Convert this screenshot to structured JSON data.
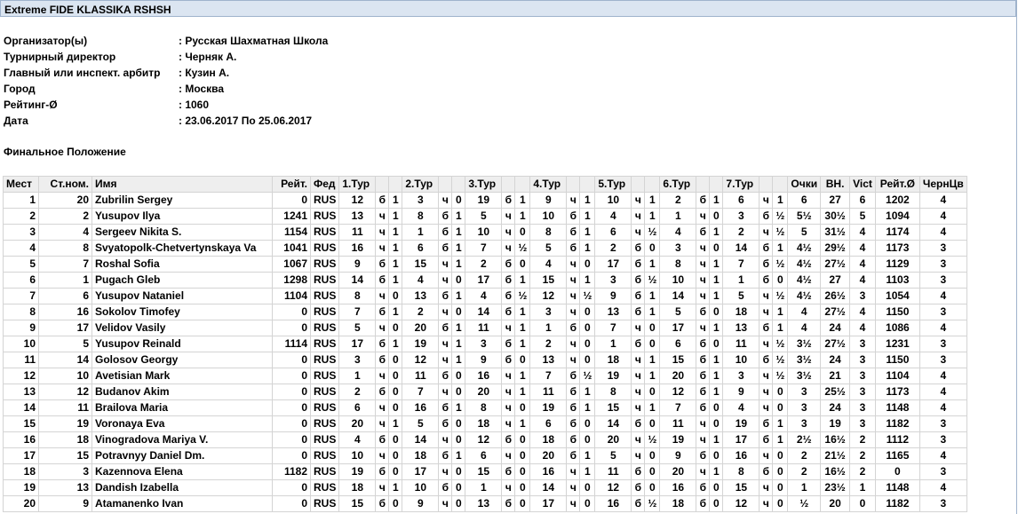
{
  "title": "Extreme FIDE KLASSIKA RSHSH",
  "info": [
    {
      "label": "Организатор(ы)",
      "value": ": Русская Шахматная Школа"
    },
    {
      "label": "Турнирный директор",
      "value": ": Черняк А."
    },
    {
      "label": "Главный или инспект. арбитр",
      "value": ": Кузин А."
    },
    {
      "label": "Город",
      "value": ": Москва"
    },
    {
      "label": "Рейтинг-Ø",
      "value": ": 1060"
    },
    {
      "label": "Дата",
      "value": ": 23.06.2017 По 25.06.2017"
    }
  ],
  "section_title": "Финальное Положение",
  "headers": {
    "place": "Мест",
    "start_no": "Ст.ном.",
    "name": "Имя",
    "rating": "Рейт.",
    "fed": "Фед",
    "rounds": [
      "1.Тур",
      "2.Тур",
      "3.Тур",
      "4.Тур",
      "5.Тур",
      "6.Тур",
      "7.Тур"
    ],
    "points": "Очки",
    "buchholz": "ВН.",
    "wins": "Vict",
    "avg_rating": "Рейт.Ø",
    "blacks": "ЧернЦв"
  },
  "rows": [
    {
      "place": "1",
      "start_no": "20",
      "name": "Zubrilin Sergey",
      "rating": "0",
      "fed": "RUS",
      "rounds": [
        [
          "12",
          "б",
          "1"
        ],
        [
          "3",
          "ч",
          "0"
        ],
        [
          "19",
          "б",
          "1"
        ],
        [
          "9",
          "ч",
          "1"
        ],
        [
          "10",
          "ч",
          "1"
        ],
        [
          "2",
          "б",
          "1"
        ],
        [
          "6",
          "ч",
          "1"
        ]
      ],
      "points": "6",
      "buchholz": "27",
      "wins": "6",
      "avg_rating": "1202",
      "blacks": "4"
    },
    {
      "place": "2",
      "start_no": "2",
      "name": "Yusupov Ilya",
      "rating": "1241",
      "fed": "RUS",
      "rounds": [
        [
          "13",
          "ч",
          "1"
        ],
        [
          "8",
          "б",
          "1"
        ],
        [
          "5",
          "ч",
          "1"
        ],
        [
          "10",
          "б",
          "1"
        ],
        [
          "4",
          "ч",
          "1"
        ],
        [
          "1",
          "ч",
          "0"
        ],
        [
          "3",
          "б",
          "½"
        ]
      ],
      "points": "5½",
      "buchholz": "30½",
      "wins": "5",
      "avg_rating": "1094",
      "blacks": "4"
    },
    {
      "place": "3",
      "start_no": "4",
      "name": "Sergeev Nikita S.",
      "rating": "1154",
      "fed": "RUS",
      "rounds": [
        [
          "11",
          "ч",
          "1"
        ],
        [
          "1",
          "б",
          "1"
        ],
        [
          "10",
          "ч",
          "0"
        ],
        [
          "8",
          "б",
          "1"
        ],
        [
          "6",
          "ч",
          "½"
        ],
        [
          "4",
          "б",
          "1"
        ],
        [
          "2",
          "ч",
          "½"
        ]
      ],
      "points": "5",
      "buchholz": "31½",
      "wins": "4",
      "avg_rating": "1174",
      "blacks": "4"
    },
    {
      "place": "4",
      "start_no": "8",
      "name": "Svyatopolk-Chetvertynskaya Va",
      "rating": "1041",
      "fed": "RUS",
      "rounds": [
        [
          "16",
          "ч",
          "1"
        ],
        [
          "6",
          "б",
          "1"
        ],
        [
          "7",
          "ч",
          "½"
        ],
        [
          "5",
          "б",
          "1"
        ],
        [
          "2",
          "б",
          "0"
        ],
        [
          "3",
          "ч",
          "0"
        ],
        [
          "14",
          "б",
          "1"
        ]
      ],
      "points": "4½",
      "buchholz": "29½",
      "wins": "4",
      "avg_rating": "1173",
      "blacks": "3"
    },
    {
      "place": "5",
      "start_no": "7",
      "name": "Roshal Sofia",
      "rating": "1067",
      "fed": "RUS",
      "rounds": [
        [
          "9",
          "б",
          "1"
        ],
        [
          "15",
          "ч",
          "1"
        ],
        [
          "2",
          "б",
          "0"
        ],
        [
          "4",
          "ч",
          "0"
        ],
        [
          "17",
          "б",
          "1"
        ],
        [
          "8",
          "ч",
          "1"
        ],
        [
          "7",
          "б",
          "½"
        ]
      ],
      "points": "4½",
      "buchholz": "27½",
      "wins": "4",
      "avg_rating": "1129",
      "blacks": "3"
    },
    {
      "place": "6",
      "start_no": "1",
      "name": "Pugach Gleb",
      "rating": "1298",
      "fed": "RUS",
      "rounds": [
        [
          "14",
          "б",
          "1"
        ],
        [
          "4",
          "ч",
          "0"
        ],
        [
          "17",
          "б",
          "1"
        ],
        [
          "15",
          "ч",
          "1"
        ],
        [
          "3",
          "б",
          "½"
        ],
        [
          "10",
          "ч",
          "1"
        ],
        [
          "1",
          "б",
          "0"
        ]
      ],
      "points": "4½",
      "buchholz": "27",
      "wins": "4",
      "avg_rating": "1103",
      "blacks": "3"
    },
    {
      "place": "7",
      "start_no": "6",
      "name": "Yusupov Nataniel",
      "rating": "1104",
      "fed": "RUS",
      "rounds": [
        [
          "8",
          "ч",
          "0"
        ],
        [
          "13",
          "б",
          "1"
        ],
        [
          "4",
          "б",
          "½"
        ],
        [
          "12",
          "ч",
          "½"
        ],
        [
          "9",
          "б",
          "1"
        ],
        [
          "14",
          "ч",
          "1"
        ],
        [
          "5",
          "ч",
          "½"
        ]
      ],
      "points": "4½",
      "buchholz": "26½",
      "wins": "3",
      "avg_rating": "1054",
      "blacks": "4"
    },
    {
      "place": "8",
      "start_no": "16",
      "name": "Sokolov Timofey",
      "rating": "0",
      "fed": "RUS",
      "rounds": [
        [
          "7",
          "б",
          "1"
        ],
        [
          "2",
          "ч",
          "0"
        ],
        [
          "14",
          "б",
          "1"
        ],
        [
          "3",
          "ч",
          "0"
        ],
        [
          "13",
          "б",
          "1"
        ],
        [
          "5",
          "б",
          "0"
        ],
        [
          "18",
          "ч",
          "1"
        ]
      ],
      "points": "4",
      "buchholz": "27½",
      "wins": "4",
      "avg_rating": "1150",
      "blacks": "3"
    },
    {
      "place": "9",
      "start_no": "17",
      "name": "Velidov Vasily",
      "rating": "0",
      "fed": "RUS",
      "rounds": [
        [
          "5",
          "ч",
          "0"
        ],
        [
          "20",
          "б",
          "1"
        ],
        [
          "11",
          "ч",
          "1"
        ],
        [
          "1",
          "б",
          "0"
        ],
        [
          "7",
          "ч",
          "0"
        ],
        [
          "17",
          "ч",
          "1"
        ],
        [
          "13",
          "б",
          "1"
        ]
      ],
      "points": "4",
      "buchholz": "24",
      "wins": "4",
      "avg_rating": "1086",
      "blacks": "4"
    },
    {
      "place": "10",
      "start_no": "5",
      "name": "Yusupov Reinald",
      "rating": "1114",
      "fed": "RUS",
      "rounds": [
        [
          "17",
          "б",
          "1"
        ],
        [
          "19",
          "ч",
          "1"
        ],
        [
          "3",
          "б",
          "1"
        ],
        [
          "2",
          "ч",
          "0"
        ],
        [
          "1",
          "б",
          "0"
        ],
        [
          "6",
          "б",
          "0"
        ],
        [
          "11",
          "ч",
          "½"
        ]
      ],
      "points": "3½",
      "buchholz": "27½",
      "wins": "3",
      "avg_rating": "1231",
      "blacks": "3"
    },
    {
      "place": "11",
      "start_no": "14",
      "name": "Golosov Georgy",
      "rating": "0",
      "fed": "RUS",
      "rounds": [
        [
          "3",
          "б",
          "0"
        ],
        [
          "12",
          "ч",
          "1"
        ],
        [
          "9",
          "б",
          "0"
        ],
        [
          "13",
          "ч",
          "0"
        ],
        [
          "18",
          "ч",
          "1"
        ],
        [
          "15",
          "б",
          "1"
        ],
        [
          "10",
          "б",
          "½"
        ]
      ],
      "points": "3½",
      "buchholz": "24",
      "wins": "3",
      "avg_rating": "1150",
      "blacks": "3"
    },
    {
      "place": "12",
      "start_no": "10",
      "name": "Avetisian Mark",
      "rating": "0",
      "fed": "RUS",
      "rounds": [
        [
          "1",
          "ч",
          "0"
        ],
        [
          "11",
          "б",
          "0"
        ],
        [
          "16",
          "ч",
          "1"
        ],
        [
          "7",
          "б",
          "½"
        ],
        [
          "19",
          "ч",
          "1"
        ],
        [
          "20",
          "б",
          "1"
        ],
        [
          "3",
          "ч",
          "½"
        ]
      ],
      "points": "3½",
      "buchholz": "21",
      "wins": "3",
      "avg_rating": "1104",
      "blacks": "4"
    },
    {
      "place": "13",
      "start_no": "12",
      "name": "Budanov Akim",
      "rating": "0",
      "fed": "RUS",
      "rounds": [
        [
          "2",
          "б",
          "0"
        ],
        [
          "7",
          "ч",
          "0"
        ],
        [
          "20",
          "ч",
          "1"
        ],
        [
          "11",
          "б",
          "1"
        ],
        [
          "8",
          "ч",
          "0"
        ],
        [
          "12",
          "б",
          "1"
        ],
        [
          "9",
          "ч",
          "0"
        ]
      ],
      "points": "3",
      "buchholz": "25½",
      "wins": "3",
      "avg_rating": "1173",
      "blacks": "4"
    },
    {
      "place": "14",
      "start_no": "11",
      "name": "Brailova Maria",
      "rating": "0",
      "fed": "RUS",
      "rounds": [
        [
          "6",
          "ч",
          "0"
        ],
        [
          "16",
          "б",
          "1"
        ],
        [
          "8",
          "ч",
          "0"
        ],
        [
          "19",
          "б",
          "1"
        ],
        [
          "15",
          "ч",
          "1"
        ],
        [
          "7",
          "б",
          "0"
        ],
        [
          "4",
          "ч",
          "0"
        ]
      ],
      "points": "3",
      "buchholz": "24",
      "wins": "3",
      "avg_rating": "1148",
      "blacks": "4"
    },
    {
      "place": "15",
      "start_no": "19",
      "name": "Voronaya Eva",
      "rating": "0",
      "fed": "RUS",
      "rounds": [
        [
          "20",
          "ч",
          "1"
        ],
        [
          "5",
          "б",
          "0"
        ],
        [
          "18",
          "ч",
          "1"
        ],
        [
          "6",
          "б",
          "0"
        ],
        [
          "14",
          "б",
          "0"
        ],
        [
          "11",
          "ч",
          "0"
        ],
        [
          "19",
          "б",
          "1"
        ]
      ],
      "points": "3",
      "buchholz": "19",
      "wins": "3",
      "avg_rating": "1182",
      "blacks": "3"
    },
    {
      "place": "16",
      "start_no": "18",
      "name": "Vinogradova Mariya V.",
      "rating": "0",
      "fed": "RUS",
      "rounds": [
        [
          "4",
          "б",
          "0"
        ],
        [
          "14",
          "ч",
          "0"
        ],
        [
          "12",
          "б",
          "0"
        ],
        [
          "18",
          "б",
          "0"
        ],
        [
          "20",
          "ч",
          "½"
        ],
        [
          "19",
          "ч",
          "1"
        ],
        [
          "17",
          "б",
          "1"
        ]
      ],
      "points": "2½",
      "buchholz": "16½",
      "wins": "2",
      "avg_rating": "1112",
      "blacks": "3"
    },
    {
      "place": "17",
      "start_no": "15",
      "name": "Potravnyy Daniel Dm.",
      "rating": "0",
      "fed": "RUS",
      "rounds": [
        [
          "10",
          "ч",
          "0"
        ],
        [
          "18",
          "б",
          "1"
        ],
        [
          "6",
          "ч",
          "0"
        ],
        [
          "20",
          "б",
          "1"
        ],
        [
          "5",
          "ч",
          "0"
        ],
        [
          "9",
          "б",
          "0"
        ],
        [
          "16",
          "ч",
          "0"
        ]
      ],
      "points": "2",
      "buchholz": "21½",
      "wins": "2",
      "avg_rating": "1165",
      "blacks": "4"
    },
    {
      "place": "18",
      "start_no": "3",
      "name": "Kazennova Elena",
      "rating": "1182",
      "fed": "RUS",
      "rounds": [
        [
          "19",
          "б",
          "0"
        ],
        [
          "17",
          "ч",
          "0"
        ],
        [
          "15",
          "б",
          "0"
        ],
        [
          "16",
          "ч",
          "1"
        ],
        [
          "11",
          "б",
          "0"
        ],
        [
          "20",
          "ч",
          "1"
        ],
        [
          "8",
          "б",
          "0"
        ]
      ],
      "points": "2",
      "buchholz": "16½",
      "wins": "2",
      "avg_rating": "0",
      "blacks": "3"
    },
    {
      "place": "19",
      "start_no": "13",
      "name": "Dandish Izabella",
      "rating": "0",
      "fed": "RUS",
      "rounds": [
        [
          "18",
          "ч",
          "1"
        ],
        [
          "10",
          "б",
          "0"
        ],
        [
          "1",
          "ч",
          "0"
        ],
        [
          "14",
          "ч",
          "0"
        ],
        [
          "12",
          "б",
          "0"
        ],
        [
          "16",
          "б",
          "0"
        ],
        [
          "15",
          "ч",
          "0"
        ]
      ],
      "points": "1",
      "buchholz": "23½",
      "wins": "1",
      "avg_rating": "1148",
      "blacks": "4"
    },
    {
      "place": "20",
      "start_no": "9",
      "name": "Atamanenko Ivan",
      "rating": "0",
      "fed": "RUS",
      "rounds": [
        [
          "15",
          "б",
          "0"
        ],
        [
          "9",
          "ч",
          "0"
        ],
        [
          "13",
          "б",
          "0"
        ],
        [
          "17",
          "ч",
          "0"
        ],
        [
          "16",
          "б",
          "½"
        ],
        [
          "18",
          "б",
          "0"
        ],
        [
          "12",
          "ч",
          "0"
        ]
      ],
      "points": "½",
      "buchholz": "20",
      "wins": "0",
      "avg_rating": "1182",
      "blacks": "3"
    }
  ]
}
